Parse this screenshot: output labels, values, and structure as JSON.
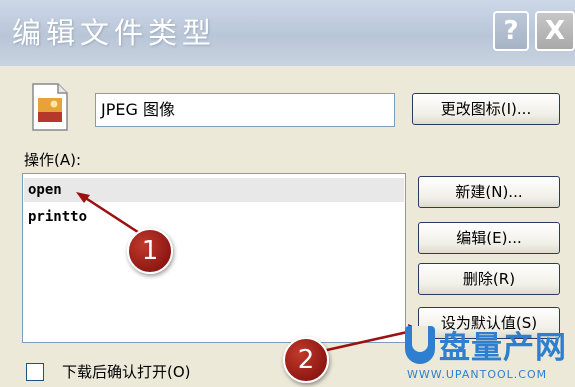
{
  "window": {
    "title": "编辑文件类型",
    "help_label": "?",
    "close_label": "X"
  },
  "file_type": {
    "icon": "jpeg-file-icon",
    "name": "JPEG 图像",
    "change_icon_label": "更改图标(I)..."
  },
  "actions": {
    "label": "操作(A):",
    "items": [
      {
        "label": "open",
        "selected": true
      },
      {
        "label": "printto",
        "selected": false
      }
    ]
  },
  "buttons": {
    "new_label": "新建(N)...",
    "edit_label": "编辑(E)...",
    "delete_label": "删除(R)",
    "set_default_label": "设为默认值(S)"
  },
  "options": {
    "confirm_open_label": "下载后确认打开(O)",
    "confirm_open_checked": false
  },
  "annotations": {
    "marker_1": "1",
    "marker_2": "2",
    "color": "#8b0f0f"
  },
  "watermark": {
    "brand": "盘量产网",
    "url": "WWW.UPANTOOL.COM"
  }
}
